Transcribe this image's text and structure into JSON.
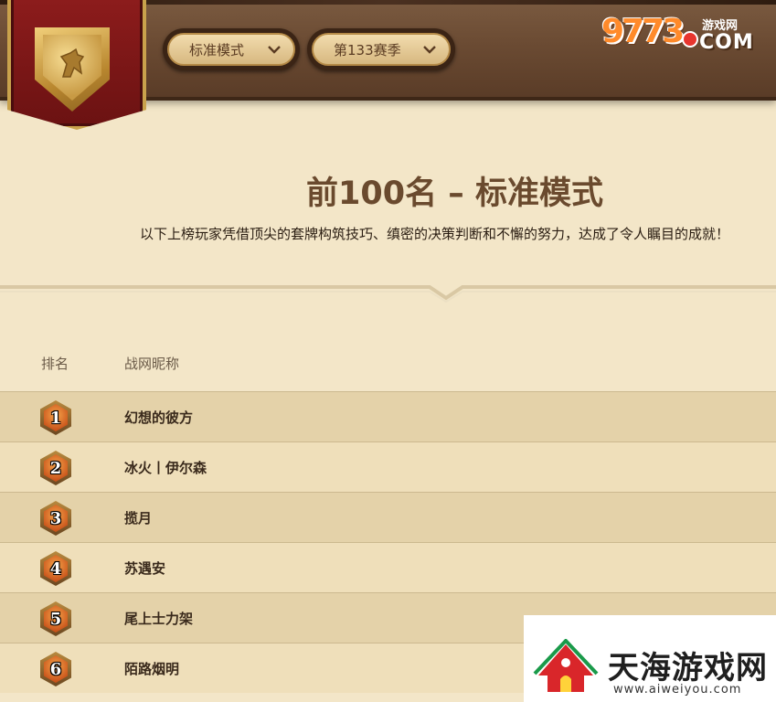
{
  "header": {
    "mode_dropdown": {
      "selected": "标准模式"
    },
    "season_dropdown": {
      "selected": "第133赛季"
    },
    "site_logo": {
      "digits": "9773",
      "site_cn": "游戏网",
      "domain": "COM"
    }
  },
  "main": {
    "title": "前100名 – 标准模式",
    "subtitle": "以下上榜玩家凭借顶尖的套牌构筑技巧、缜密的决策判断和不懈的努力，达成了令人瞩目的成就！"
  },
  "table": {
    "columns": {
      "rank": "排名",
      "name": "战网昵称"
    },
    "rows": [
      {
        "rank": "1",
        "name": "幻想的彼方"
      },
      {
        "rank": "2",
        "name": "冰火丨伊尔森"
      },
      {
        "rank": "3",
        "name": "揽月"
      },
      {
        "rank": "4",
        "name": "苏遇安"
      },
      {
        "rank": "5",
        "name": "尾上士力架"
      },
      {
        "rank": "6",
        "name": "陌路烟明"
      }
    ]
  },
  "watermark": {
    "brand": "天海游戏网",
    "url": "www.aiweiyou.com"
  },
  "colors": {
    "topbar": "#6b4b33",
    "banner_red": "#8d1c1c",
    "gold": "#c9a24c",
    "title": "#6a4a2e",
    "row_dark": "#e4d2a9",
    "row_light": "#efdfba"
  }
}
